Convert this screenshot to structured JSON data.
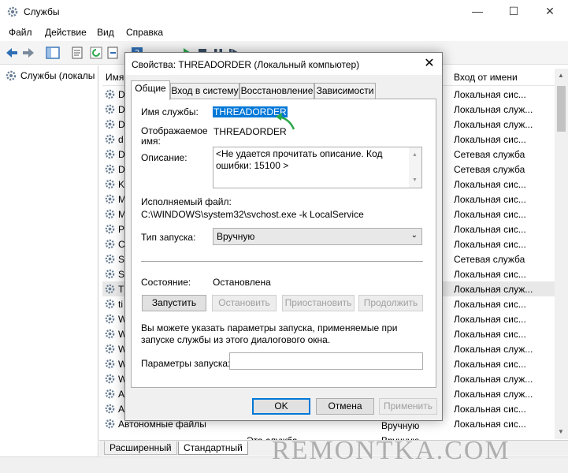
{
  "window": {
    "title": "Службы"
  },
  "menu": [
    "Файл",
    "Действие",
    "Вид",
    "Справка"
  ],
  "left_tree": {
    "root": "Службы (локалы"
  },
  "services_header": {
    "name": "Имя",
    "logon": "Вход от имени"
  },
  "services": [
    {
      "name": "D",
      "logon": "Локальная сис..."
    },
    {
      "name": "D",
      "logon": "Локальная служ..."
    },
    {
      "name": "D",
      "logon": "Локальная служ..."
    },
    {
      "name": "d",
      "logon": "Локальная сис..."
    },
    {
      "name": "D",
      "logon": "Сетевая служба"
    },
    {
      "name": "D",
      "logon": "Сетевая служба"
    },
    {
      "name": "K",
      "logon": "Локальная сис..."
    },
    {
      "name": "M",
      "logon": "Локальная сис..."
    },
    {
      "name": "M",
      "logon": "Локальная сис..."
    },
    {
      "name": "P",
      "logon": "Локальная сис..."
    },
    {
      "name": "C",
      "logon": "Локальная сис..."
    },
    {
      "name": "S",
      "logon": "Сетевая служба"
    },
    {
      "name": "S",
      "logon": "Локальная сис..."
    },
    {
      "name": "T",
      "logon": "Локальная служ..."
    },
    {
      "name": "ti",
      "logon": "Локальная сис..."
    },
    {
      "name": "W",
      "logon": "Локальная сис..."
    },
    {
      "name": "W",
      "logon": "Локальная сис..."
    },
    {
      "name": "W",
      "logon": "Локальная служ..."
    },
    {
      "name": "W",
      "logon": "Локальная сис..."
    },
    {
      "name": "W",
      "logon": "Локальная служ..."
    },
    {
      "name": "A",
      "logon": "Локальная служ..."
    },
    {
      "name": "Автонастройка WWAN",
      "logon": "Локальная сис..."
    },
    {
      "name": "Автономные файлы",
      "logon": "Локальная сис..."
    }
  ],
  "row_extra": {
    "partial_desc": "Эта служба ...",
    "partial_start": "Вручную"
  },
  "bottom_tabs": [
    "Расширенный",
    "Стандартный"
  ],
  "dialog": {
    "title": "Свойства: THREADORDER (Локальный компьютер)",
    "tabs": [
      "Общие",
      "Вход в систему",
      "Восстановление",
      "Зависимости"
    ],
    "service_name_label": "Имя службы:",
    "service_name": "THREADORDER",
    "display_name_label_1": "Отображаемое",
    "display_name_label_2": "имя:",
    "display_name": "THREADORDER",
    "description_label": "Описание:",
    "description": "<Не удается прочитать описание. Код ошибки: 15100 >",
    "exe_label": "Исполняемый файл:",
    "exe_path": "C:\\WINDOWS\\system32\\svchost.exe -k LocalService",
    "startup_label": "Тип запуска:",
    "startup_value": "Вручную",
    "state_label": "Состояние:",
    "state_value": "Остановлена",
    "btn_start": "Запустить",
    "btn_stop": "Остановить",
    "btn_pause": "Приостановить",
    "btn_resume": "Продолжить",
    "hint": "Вы можете указать параметры запуска, применяемые при запуске службы из этого диалогового окна.",
    "params_label": "Параметры запуска:",
    "params_value": "",
    "btn_ok": "OK",
    "btn_cancel": "Отмена",
    "btn_apply": "Применить"
  },
  "watermark": "REMONTKA.COM",
  "colors": {
    "selection": "#0078d7",
    "arrow": "#2aa84a"
  }
}
